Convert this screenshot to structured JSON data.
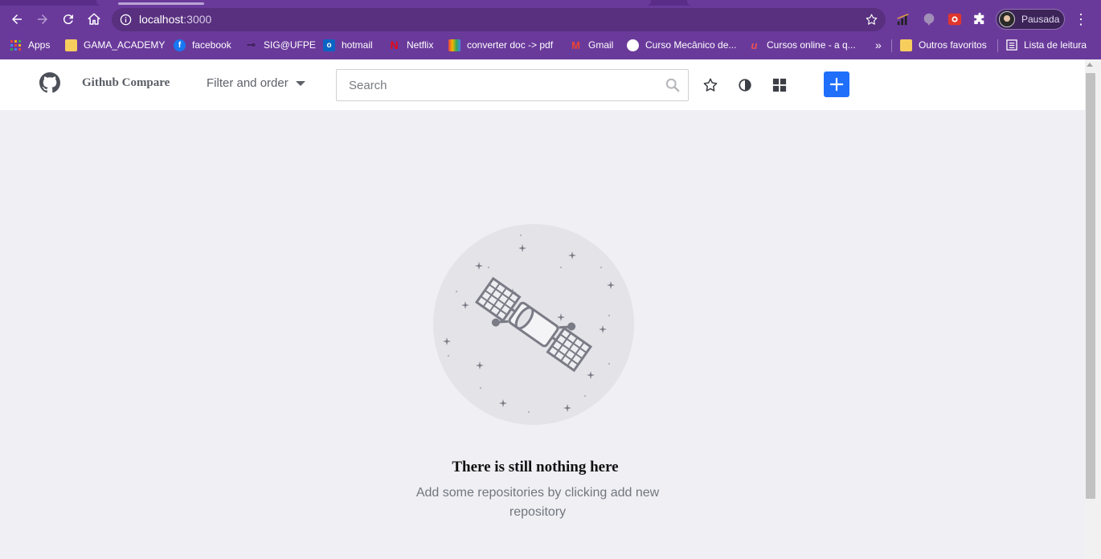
{
  "browser": {
    "url_host": "localhost",
    "url_port": ":3000",
    "profile_label": "Pausada",
    "bookmarks": [
      {
        "label": "Apps",
        "icon": "apps-grid-icon",
        "color": "#e8453c"
      },
      {
        "label": "GAMA_ACADEMY",
        "icon": "folder-icon",
        "color": "#f7cd5e"
      },
      {
        "label": "facebook",
        "icon": "facebook-icon",
        "color": "#1877f2"
      },
      {
        "label": "SIG@UFPE",
        "icon": "sig-icon",
        "color": "#3b1f55"
      },
      {
        "label": "hotmail",
        "icon": "outlook-icon",
        "color": "#0a64c4"
      },
      {
        "label": "Netflix",
        "icon": "netflix-icon",
        "color": "#e50914"
      },
      {
        "label": "converter doc -> pdf",
        "icon": "converter-icon",
        "color": "#f0a30a"
      },
      {
        "label": "Gmail",
        "icon": "gmail-icon",
        "color": "#ea4335"
      },
      {
        "label": "Curso Mecânico de...",
        "icon": "course-icon",
        "color": "#ffffff"
      },
      {
        "label": "Cursos online - a q...",
        "icon": "udemy-icon",
        "color": "#ec5252"
      }
    ],
    "overflow_label": "»",
    "other_favorites": "Outros favoritos",
    "reading_list": "Lista de leitura"
  },
  "app": {
    "title": "Github Compare",
    "filter_label": "Filter and order",
    "search_placeholder": "Search",
    "accent_color": "#1f6ffb"
  },
  "empty_state": {
    "title": "There is still nothing here",
    "subtitle": "Add some repositories by clicking add new repository",
    "illustration": "satellite-illustration"
  }
}
